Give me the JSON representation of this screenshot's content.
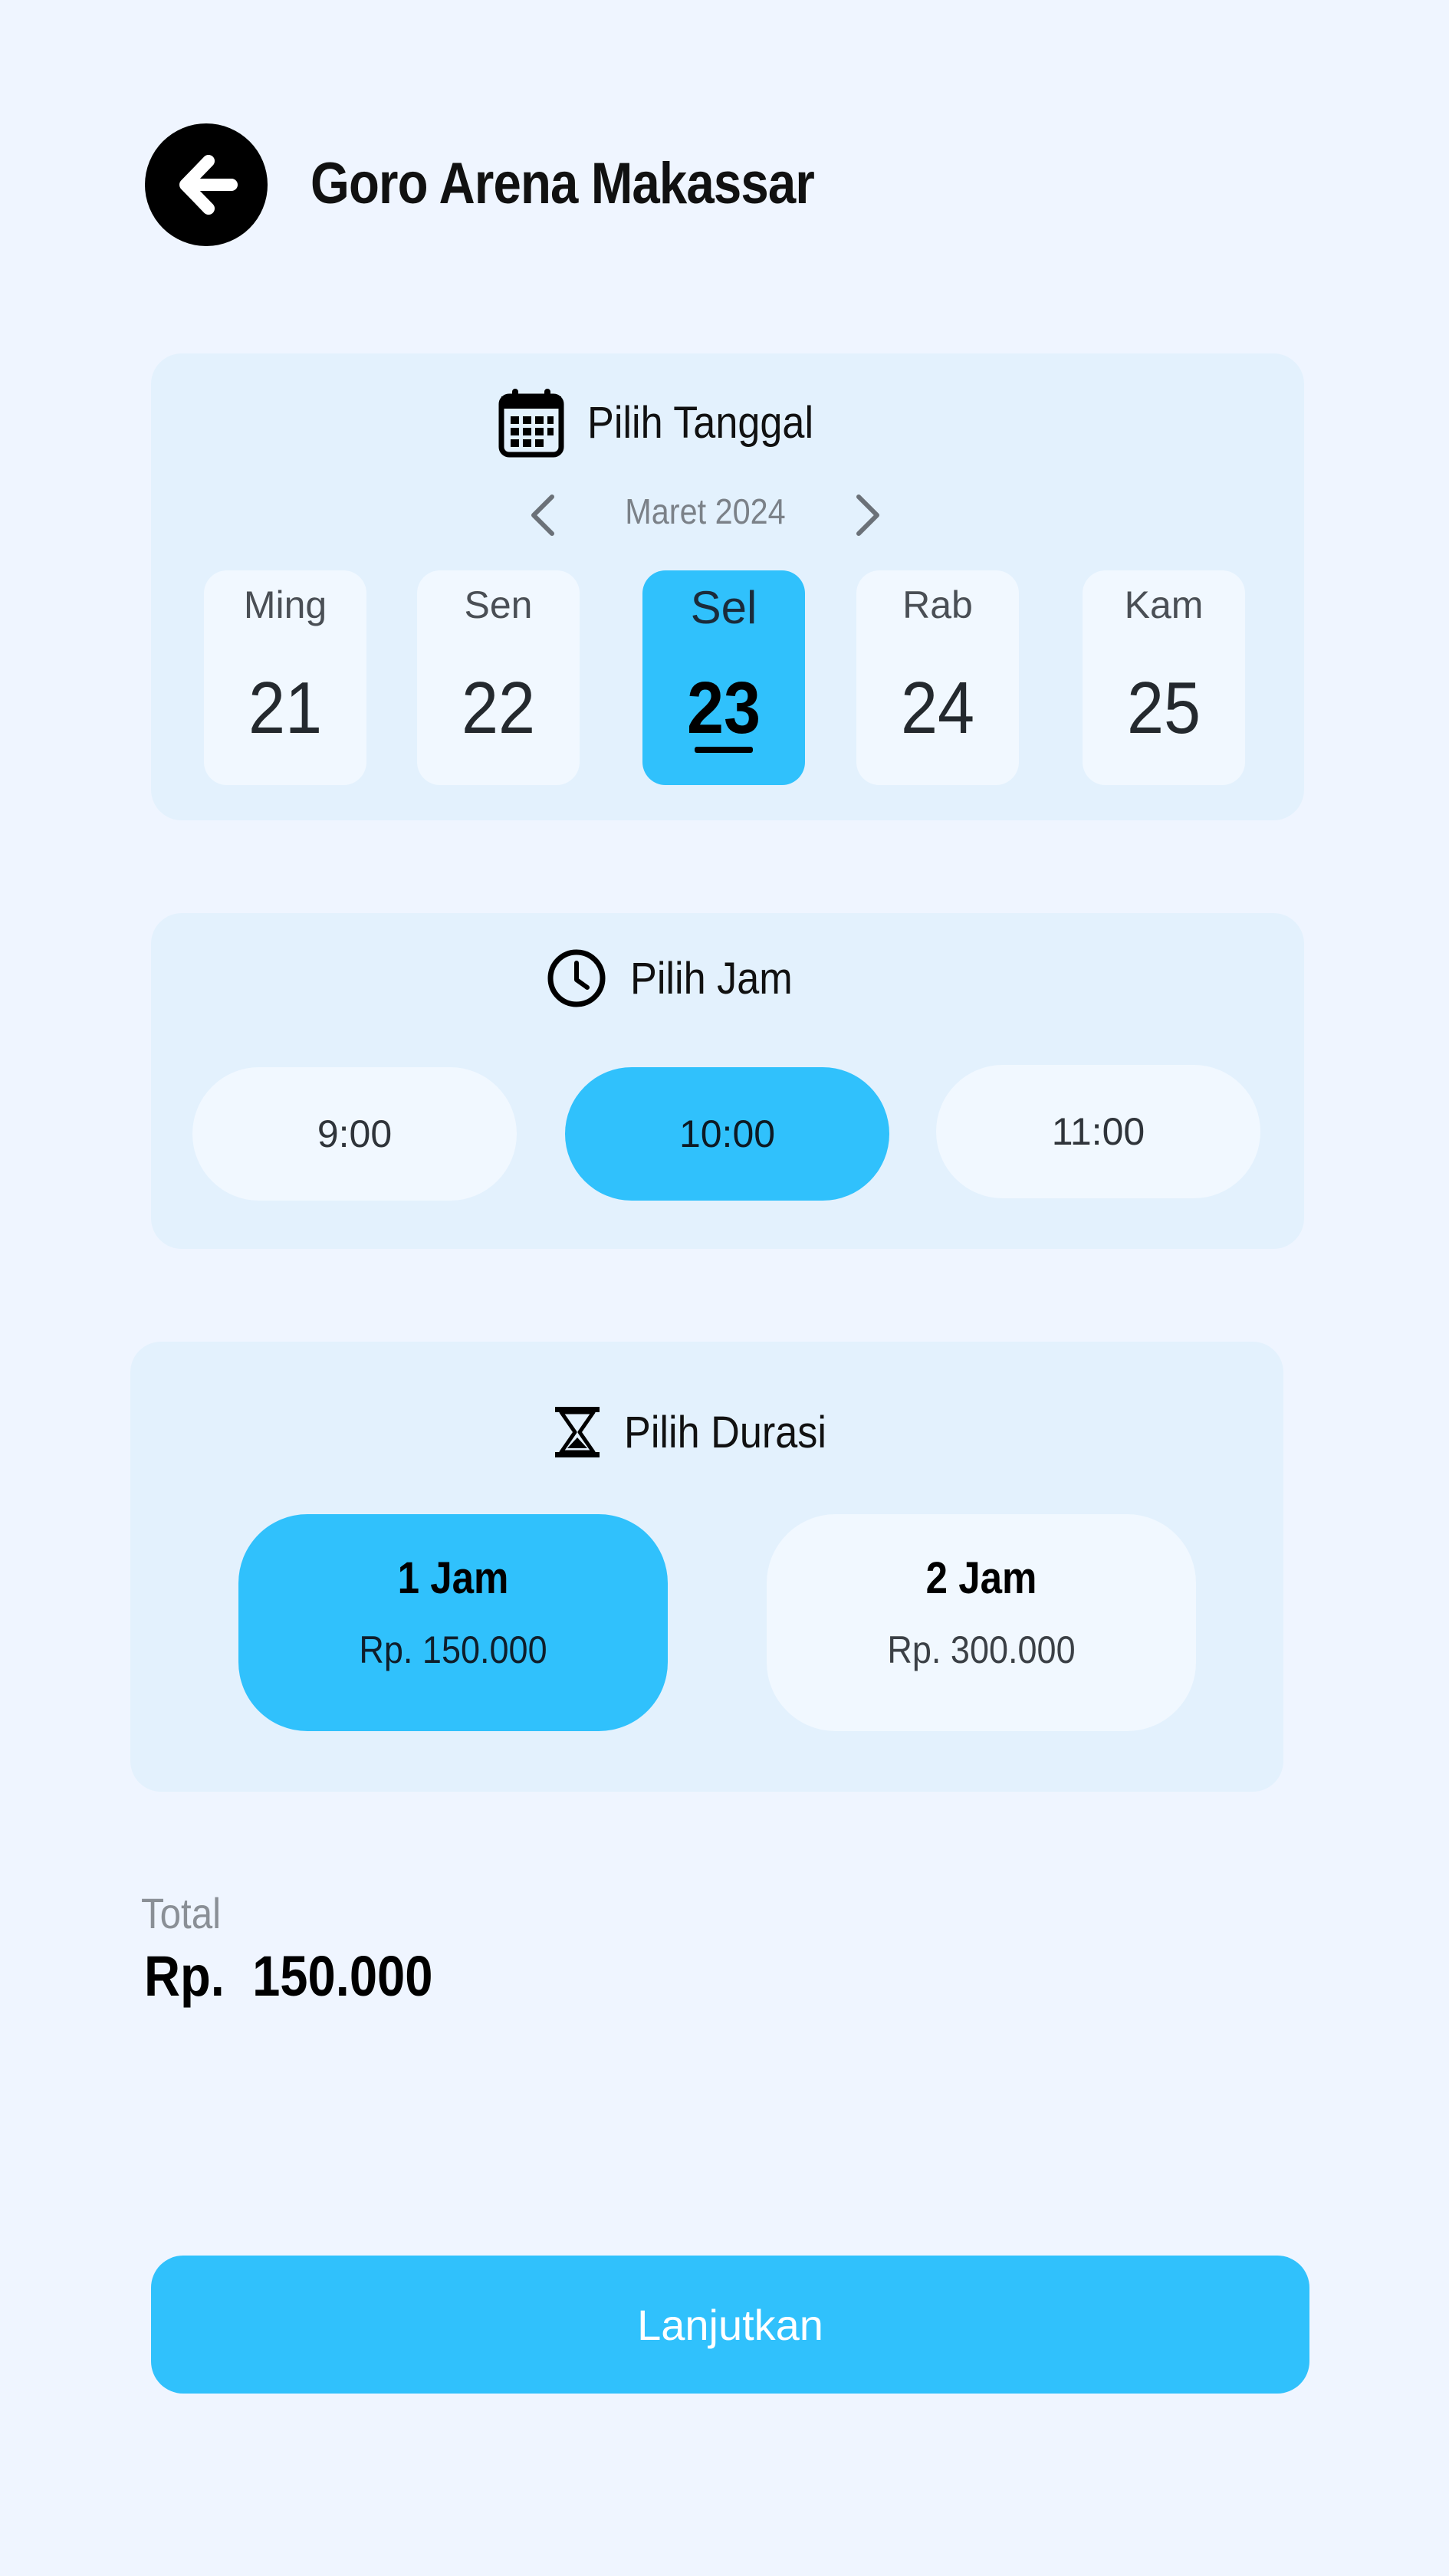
{
  "header": {
    "title": "Goro Arena Makassar",
    "back_icon": "arrow-left-icon"
  },
  "date_section": {
    "title": "Pilih Tanggal",
    "icon": "calendar-icon",
    "month": "Maret 2024",
    "days": [
      {
        "name": "Ming",
        "number": "21",
        "selected": false
      },
      {
        "name": "Sen",
        "number": "22",
        "selected": false
      },
      {
        "name": "Sel",
        "number": "23",
        "selected": true
      },
      {
        "name": "Rab",
        "number": "24",
        "selected": false
      },
      {
        "name": "Kam",
        "number": "25",
        "selected": false
      }
    ]
  },
  "time_section": {
    "title": "Pilih Jam",
    "icon": "clock-icon",
    "slots": [
      {
        "label": "9:00",
        "selected": false
      },
      {
        "label": "10:00",
        "selected": true
      },
      {
        "label": "11:00",
        "selected": false
      }
    ]
  },
  "duration_section": {
    "title": "Pilih Durasi",
    "icon": "hourglass-icon",
    "options": [
      {
        "label": "1 Jam",
        "price": "Rp. 150.000",
        "selected": true
      },
      {
        "label": "2 Jam",
        "price": "Rp. 300.000",
        "selected": false
      }
    ]
  },
  "total": {
    "label": "Total",
    "value": "Rp.  150.000"
  },
  "continue_label": "Lanjutkan",
  "colors": {
    "background": "#eff5ff",
    "card": "#e3f1fd",
    "accent": "#30c1fc",
    "tile": "#f1f8ff"
  }
}
